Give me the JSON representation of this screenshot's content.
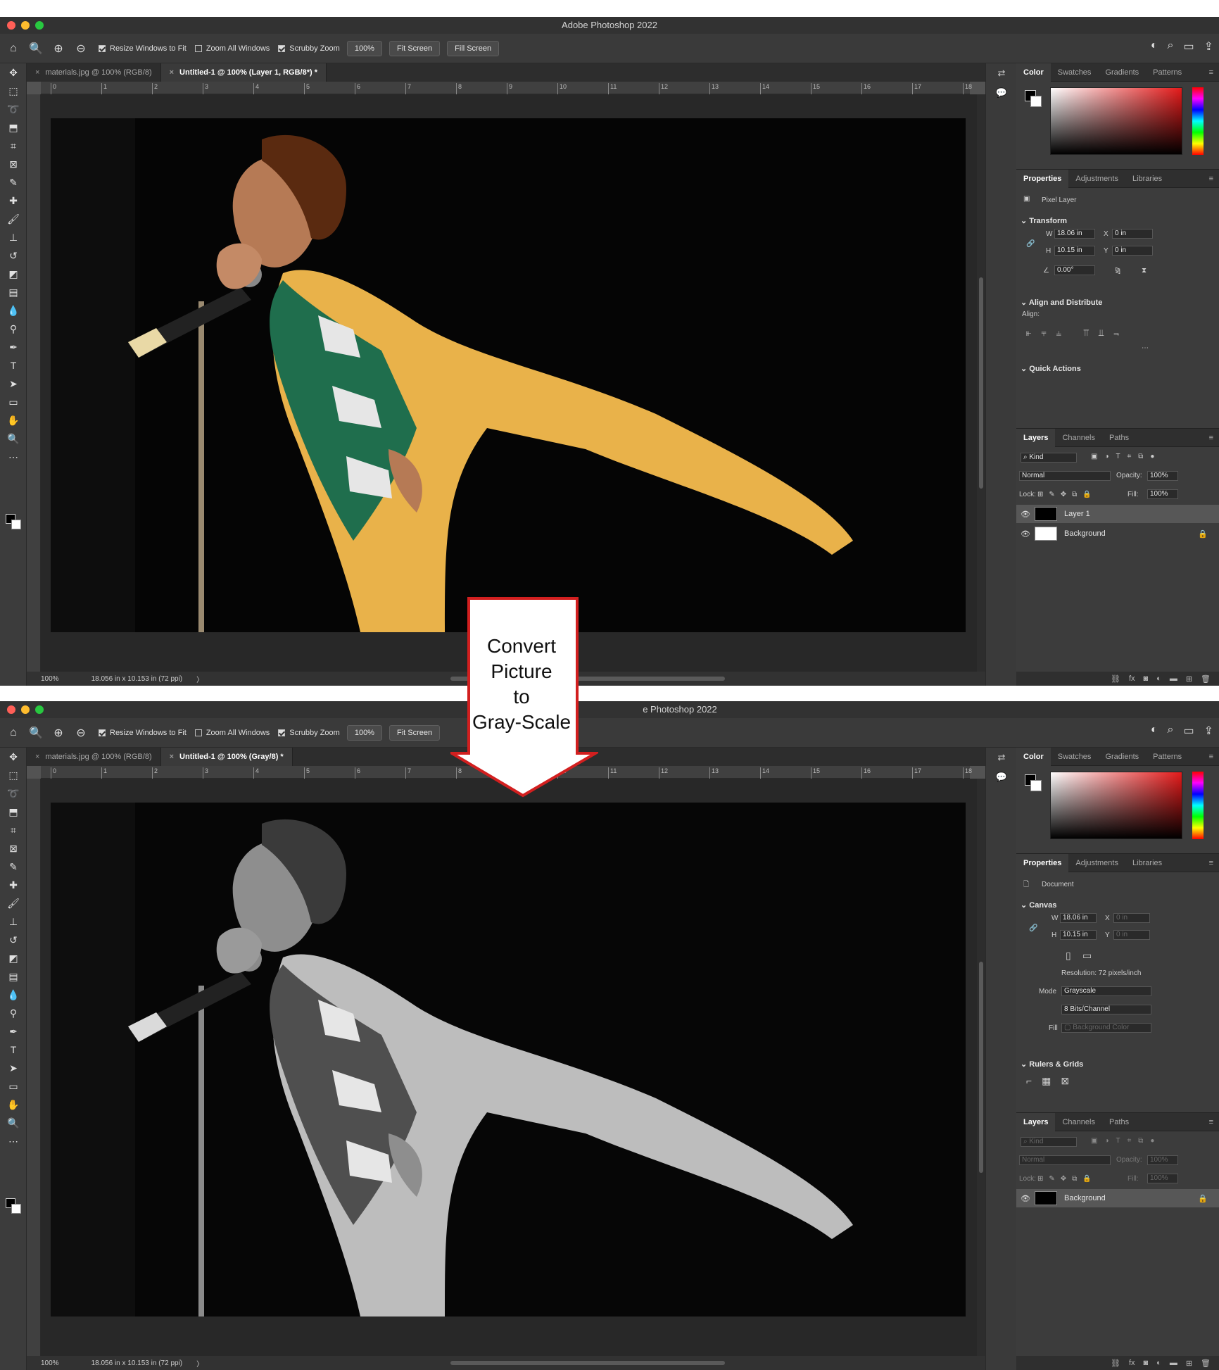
{
  "app_title": "Adobe Photoshop 2022",
  "app_title_partial": "e Photoshop 2022",
  "options": {
    "resize_windows": "Resize Windows to Fit",
    "zoom_all": "Zoom All Windows",
    "scrubby_zoom": "Scrubby Zoom",
    "zoom_value": "100%",
    "fit_screen": "Fit Screen",
    "fill_screen": "Fill Screen"
  },
  "ruler_ticks": [
    "0",
    "1",
    "2",
    "3",
    "4",
    "5",
    "6",
    "7",
    "8",
    "9",
    "10",
    "11",
    "12",
    "13",
    "14",
    "15",
    "16",
    "17",
    "18"
  ],
  "top": {
    "tab1": "materials.jpg @ 100% (RGB/8)",
    "tab2": "Untitled-1 @ 100% (Layer 1, RGB/8*) *",
    "status_zoom": "100%",
    "status_size": "18.056 in x 10.153 in (72 ppi)",
    "color_tabs": [
      "Color",
      "Swatches",
      "Gradients",
      "Patterns"
    ],
    "prop_tabs": [
      "Properties",
      "Adjustments",
      "Libraries"
    ],
    "prop_type": "Pixel Layer",
    "transform": "Transform",
    "w_label": "W",
    "w": "18.06 in",
    "h_label": "H",
    "h": "10.15 in",
    "x_label": "X",
    "x": "0 in",
    "y_label": "Y",
    "y": "0 in",
    "angle": "0.00°",
    "align_dist": "Align and Distribute",
    "align": "Align:",
    "quick_actions": "Quick Actions",
    "layer_tabs": [
      "Layers",
      "Channels",
      "Paths"
    ],
    "kind": "Kind",
    "blend": "Normal",
    "opacity_label": "Opacity:",
    "opacity": "100%",
    "lock_label": "Lock:",
    "fill_label": "Fill:",
    "fill": "100%",
    "layers": [
      "Layer 1",
      "Background"
    ]
  },
  "bottom": {
    "tab1": "materials.jpg @ 100% (RGB/8)",
    "tab2": "Untitled-1 @ 100% (Gray/8) *",
    "status_zoom": "100%",
    "status_size": "18.056 in x 10.153 in (72 ppi)",
    "color_tabs": [
      "Color",
      "Swatches",
      "Gradients",
      "Patterns"
    ],
    "prop_tabs": [
      "Properties",
      "Adjustments",
      "Libraries"
    ],
    "prop_type": "Document",
    "canvas": "Canvas",
    "w_label": "W",
    "w": "18.06 in",
    "h_label": "H",
    "h": "10.15 in",
    "x_label": "X",
    "x": "0 in",
    "y_label": "Y",
    "y": "0 in",
    "resolution": "Resolution: 72 pixels/inch",
    "mode_label": "Mode",
    "mode": "Grayscale",
    "bits": "8 Bits/Channel",
    "fill_label": "Fill",
    "fill_value": "Background Color",
    "rulers_grids": "Rulers & Grids",
    "layer_tabs": [
      "Layers",
      "Channels",
      "Paths"
    ],
    "kind": "Kind",
    "blend": "Normal",
    "opacity_label": "Opacity:",
    "opacity": "100%",
    "lock_label": "Lock:",
    "fill2_label": "Fill:",
    "fill2": "100%",
    "layers": [
      "Background"
    ]
  },
  "callout": [
    "Convert",
    "Picture",
    "to",
    "Gray-Scale"
  ],
  "colors": {
    "callout_border": "#d21f1f",
    "accent_red": "#e41a1a"
  }
}
